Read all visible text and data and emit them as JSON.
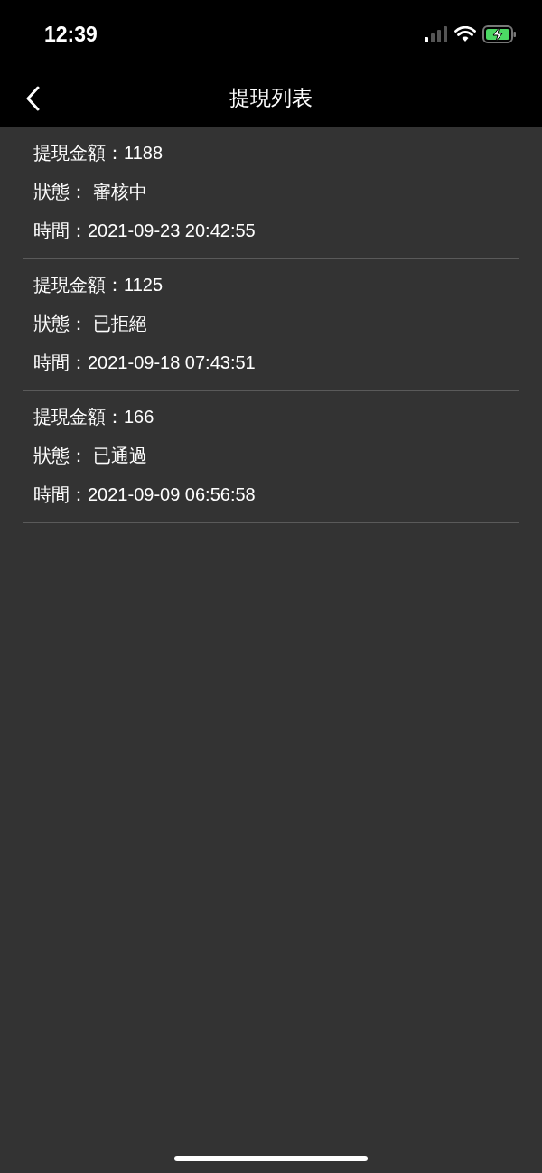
{
  "status_bar": {
    "time": "12:39"
  },
  "nav": {
    "title": "提現列表"
  },
  "records": [
    {
      "amount": "提現金額：1188",
      "status": "狀態： 審核中",
      "time": "時間：2021-09-23 20:42:55"
    },
    {
      "amount": "提現金額：1125",
      "status": "狀態： 已拒絕",
      "time": "時間：2021-09-18 07:43:51"
    },
    {
      "amount": "提現金額：166",
      "status": "狀態： 已通過",
      "time": "時間：2021-09-09 06:56:58"
    }
  ]
}
